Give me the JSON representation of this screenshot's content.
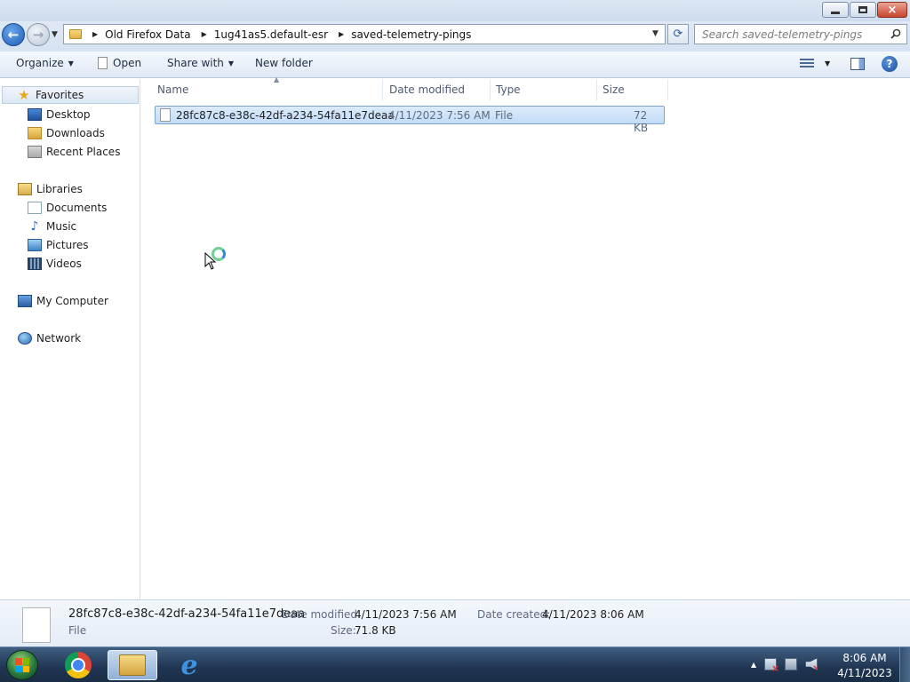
{
  "window": {
    "minimize_label": "",
    "maximize_label": "",
    "close_label": "×"
  },
  "address": {
    "breadcrumbs": [
      "Old Firefox Data",
      "1ug41as5.default-esr",
      "saved-telemetry-pings"
    ],
    "search_placeholder": "Search saved-telemetry-pings"
  },
  "toolbar": {
    "organize": "Organize",
    "open": "Open",
    "share_with": "Share with",
    "new_folder": "New folder"
  },
  "nav": {
    "favorites": "Favorites",
    "desktop": "Desktop",
    "downloads": "Downloads",
    "recent_places": "Recent Places",
    "libraries": "Libraries",
    "documents": "Documents",
    "music": "Music",
    "pictures": "Pictures",
    "videos": "Videos",
    "my_computer": "My Computer",
    "network": "Network"
  },
  "columns": {
    "name": "Name",
    "date_modified": "Date modified",
    "type": "Type",
    "size": "Size"
  },
  "files": [
    {
      "name": "28fc87c8-e38c-42df-a234-54fa11e7deaa",
      "date_modified": "4/11/2023 7:56 AM",
      "type": "File",
      "size": "72 KB"
    }
  ],
  "details": {
    "name": "28fc87c8-e38c-42df-a234-54fa11e7deaa",
    "type": "File",
    "date_modified_label": "Date modified:",
    "date_modified": "4/11/2023 7:56 AM",
    "date_created_label": "Date created:",
    "date_created": "4/11/2023 8:06 AM",
    "size_label": "Size:",
    "size": "71.8 KB"
  },
  "taskbar": {
    "time": "8:06 AM",
    "date": "4/11/2023",
    "tray_expand": "▲"
  }
}
